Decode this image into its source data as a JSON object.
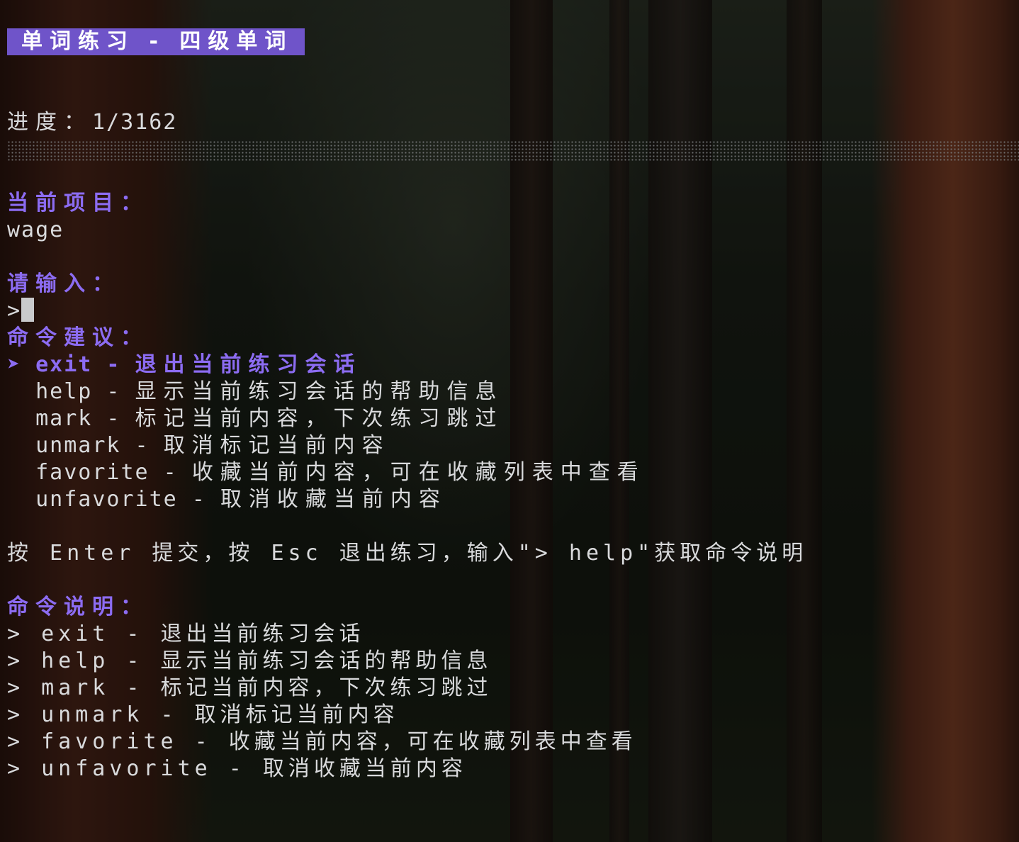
{
  "header": {
    "title": "单词练习 - 四级单词"
  },
  "progress": {
    "label": "进度：",
    "value": "1/3162"
  },
  "current": {
    "label": "当前项目：",
    "word": "wage"
  },
  "input": {
    "label": "请输入：",
    "prompt": ">",
    "value": ""
  },
  "suggestions": {
    "label": "命令建议：",
    "selected_marker": "➤",
    "items": [
      {
        "cmd": "exit",
        "desc": "退出当前练习会话"
      },
      {
        "cmd": "help",
        "desc": "显示当前练习会话的帮助信息"
      },
      {
        "cmd": "mark",
        "desc": "标记当前内容，下次练习跳过"
      },
      {
        "cmd": "unmark",
        "desc": "取消标记当前内容"
      },
      {
        "cmd": "favorite",
        "desc": "收藏当前内容，可在收藏列表中查看"
      },
      {
        "cmd": "unfavorite",
        "desc": "取消收藏当前内容"
      }
    ]
  },
  "hint": "按 Enter 提交，按 Esc 退出练习，输入\"> help\"获取命令说明",
  "help": {
    "label": "命令说明：",
    "items": [
      "> exit - 退出当前练习会话",
      "> help - 显示当前练习会话的帮助信息",
      "> mark - 标记当前内容，下次练习跳过",
      "> unmark - 取消标记当前内容",
      "> favorite - 收藏当前内容，可在收藏列表中查看",
      "> unfavorite - 取消收藏当前内容"
    ]
  },
  "colors": {
    "accent": "#8c6cf2",
    "header_bg": "#6f54c9",
    "text": "#d9dadc"
  }
}
